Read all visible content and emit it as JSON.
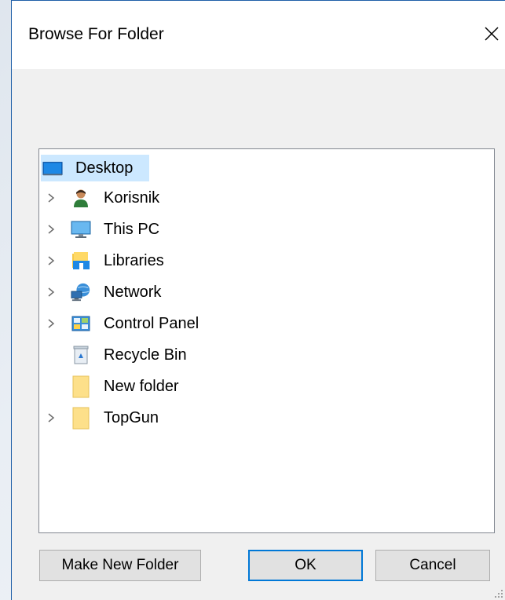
{
  "dialog": {
    "title": "Browse For Folder",
    "close_icon": "close-icon"
  },
  "tree": {
    "items": [
      {
        "label": "Desktop",
        "icon": "desktop-icon",
        "expandable": false,
        "selected": true,
        "level": 0
      },
      {
        "label": "Korisnik",
        "icon": "user-icon",
        "expandable": true,
        "selected": false,
        "level": 1
      },
      {
        "label": "This PC",
        "icon": "monitor-icon",
        "expandable": true,
        "selected": false,
        "level": 1
      },
      {
        "label": "Libraries",
        "icon": "libraries-icon",
        "expandable": true,
        "selected": false,
        "level": 1
      },
      {
        "label": "Network",
        "icon": "network-icon",
        "expandable": true,
        "selected": false,
        "level": 1
      },
      {
        "label": "Control Panel",
        "icon": "control-panel-icon",
        "expandable": true,
        "selected": false,
        "level": 1
      },
      {
        "label": "Recycle Bin",
        "icon": "recycle-bin-icon",
        "expandable": false,
        "selected": false,
        "level": 1
      },
      {
        "label": "New folder",
        "icon": "folder-icon",
        "expandable": false,
        "selected": false,
        "level": 1
      },
      {
        "label": "TopGun",
        "icon": "folder-icon",
        "expandable": true,
        "selected": false,
        "level": 1
      }
    ]
  },
  "buttons": {
    "make_new_folder": "Make New Folder",
    "ok": "OK",
    "cancel": "Cancel"
  },
  "colors": {
    "selection": "#cce8ff",
    "accent": "#0078d7",
    "window_border": "#1f5fa8"
  }
}
